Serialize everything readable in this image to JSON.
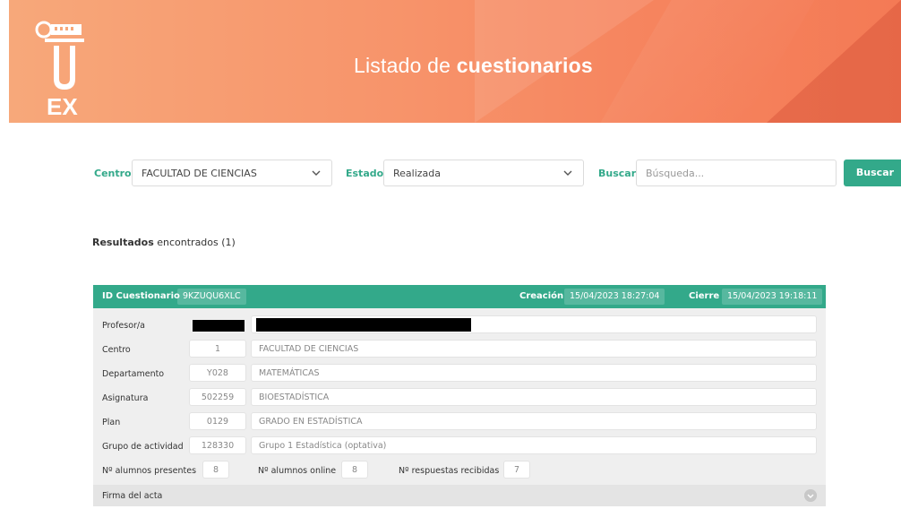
{
  "header": {
    "title_light": "Listado de ",
    "title_bold": "cuestionarios",
    "logo_text": "UEX"
  },
  "filters": {
    "centro_label": "Centro",
    "centro_value": "FACULTAD DE CIENCIAS",
    "estado_label": "Estado",
    "estado_value": "Realizada",
    "buscar_label": "Buscar",
    "search_placeholder": "Búsqueda...",
    "search_button": "Buscar"
  },
  "results": {
    "label_bold": "Resultados",
    "label_rest": " encontrados (1)"
  },
  "card": {
    "id_label": "ID Cuestionario",
    "id_value": "9KZUQU6XLC",
    "creacion_label": "Creación",
    "creacion_value": "15/04/2023 18:27:04",
    "cierre_label": "Cierre",
    "cierre_value": "15/04/2023 19:18:11",
    "rows": [
      {
        "label": "Profesor/a",
        "code": "",
        "value": ""
      },
      {
        "label": "Centro",
        "code": "1",
        "value": "FACULTAD DE CIENCIAS"
      },
      {
        "label": "Departamento",
        "code": "Y028",
        "value": "MATEMÁTICAS"
      },
      {
        "label": "Asignatura",
        "code": "502259",
        "value": "BIOESTADÍSTICA"
      },
      {
        "label": "Plan",
        "code": "0129",
        "value": "GRADO EN ESTADÍSTICA"
      },
      {
        "label": "Grupo de actividad",
        "code": "128330",
        "value": "Grupo 1 Estadística (optativa)"
      }
    ],
    "stats": {
      "presentes_label": "Nº alumnos presentes",
      "presentes_value": "8",
      "online_label": "Nº alumnos online",
      "online_value": "8",
      "respuestas_label": "Nº respuestas recibidas",
      "respuestas_value": "7"
    },
    "firma_label": "Firma del acta"
  },
  "colors": {
    "accent": "#33a98a",
    "header": "#f7936a"
  }
}
